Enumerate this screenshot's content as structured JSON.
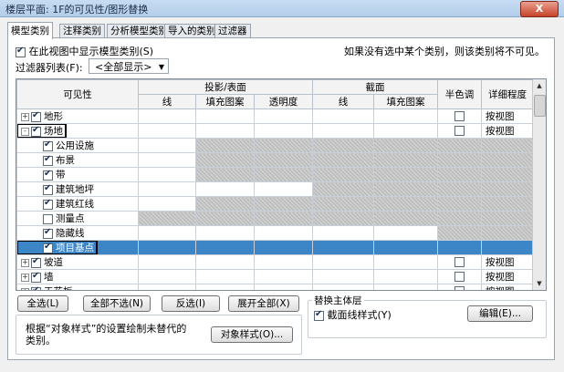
{
  "window": {
    "title": "楼层平面: 1F的可见性/图形替换",
    "close_label": "X"
  },
  "tabs": [
    "模型类别",
    "注释类别",
    "分析模型类别",
    "导入的类别",
    "过滤器"
  ],
  "show_model": {
    "label": "在此视图中显示模型类别(S)",
    "checked": true
  },
  "note": "如果没有选中某个类别，则该类别将不可见。",
  "filter_list": {
    "label": "过滤器列表(F):",
    "value": "<全部显示>"
  },
  "headers": {
    "visibility": "可见性",
    "projection": "投影/表面",
    "cut": "截面",
    "halftone": "半色调",
    "detail": "详细程度",
    "line": "线",
    "fill": "填充图案",
    "transparency": "透明度",
    "cut_line": "线",
    "cut_fill": "填充图案"
  },
  "rows": [
    {
      "name": "地形",
      "level": 0,
      "expand": "+",
      "checked": true,
      "hatch_cut": false,
      "halftone": true,
      "detail": "按视图"
    },
    {
      "name": "场地",
      "level": 0,
      "expand": "-",
      "checked": true,
      "hatch_cut": false,
      "halftone": true,
      "detail": "按视图",
      "outlined": true
    },
    {
      "name": "公用设施",
      "level": 1,
      "checked": true,
      "hatch_proj": true,
      "hatch_cut": true
    },
    {
      "name": "布景",
      "level": 1,
      "checked": true,
      "hatch_proj": true,
      "hatch_cut": true
    },
    {
      "name": "带",
      "level": 1,
      "checked": true,
      "hatch_proj": true,
      "hatch_cut": true
    },
    {
      "name": "建筑地坪",
      "level": 1,
      "checked": true,
      "hatch_cut": true
    },
    {
      "name": "建筑红线",
      "level": 1,
      "checked": true,
      "hatch_proj": true,
      "hatch_cut": true
    },
    {
      "name": "测量点",
      "level": 1,
      "checked": false,
      "hatch_all": true
    },
    {
      "name": "隐藏线",
      "level": 1,
      "checked": true
    },
    {
      "name": "项目基点",
      "level": 1,
      "checked": true,
      "selected": true,
      "outlined": true
    },
    {
      "name": "坡道",
      "level": 0,
      "expand": "+",
      "checked": true,
      "halftone": true,
      "detail": "按视图"
    },
    {
      "name": "墙",
      "level": 0,
      "expand": "+",
      "checked": true,
      "halftone": true,
      "detail": "按视图"
    },
    {
      "name": "天花板",
      "level": 0,
      "expand": "+",
      "checked": true,
      "halftone": true,
      "detail": "按视图"
    }
  ],
  "buttons": {
    "select_all": "全选(L)",
    "select_none": "全部不选(N)",
    "invert": "反选(I)",
    "expand_all": "展开全部(X)",
    "object_styles": "对象样式(O)...",
    "edit": "编辑(E)..."
  },
  "host_layers": {
    "legend": "替换主体层",
    "cut_line_styles": "截面线样式(Y)",
    "checked": true
  },
  "object_style_note": "根据“对象样式”的设置绘制未替代的类别。"
}
